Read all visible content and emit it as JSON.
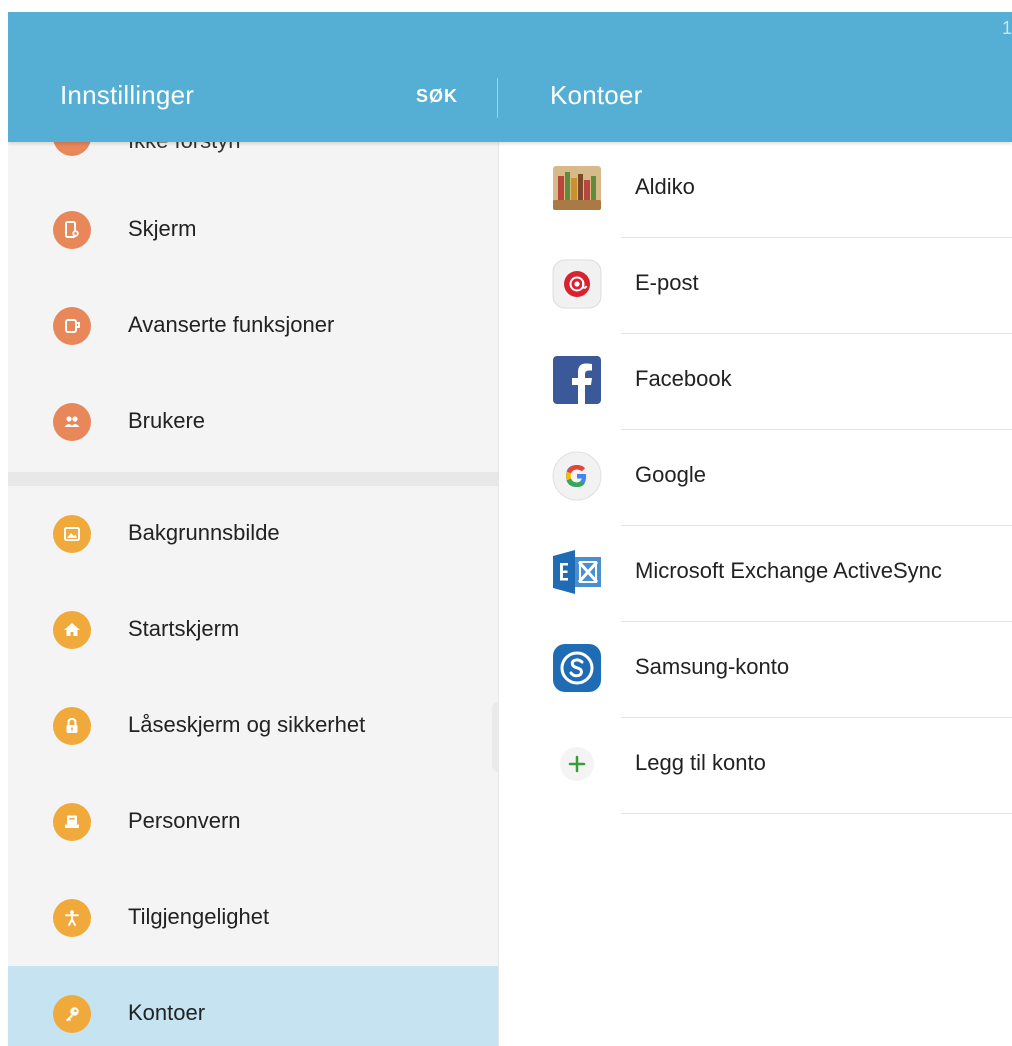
{
  "appbar": {
    "left_title": "Innstillinger",
    "search_label": "SØK",
    "right_title": "Kontoer",
    "corner_mark": "1"
  },
  "sidebar": {
    "cut_item_label": "Ikke forstyrr",
    "items": [
      {
        "label": "Skjerm",
        "icon": "display-icon",
        "color": "#e8875a"
      },
      {
        "label": "Avanserte funksjoner",
        "icon": "advanced-features-icon",
        "color": "#e8875a"
      },
      {
        "label": "Brukere",
        "icon": "users-icon",
        "color": "#e8875a"
      },
      {
        "label": "Bakgrunnsbilde",
        "icon": "wallpaper-icon",
        "color": "#f0a93b"
      },
      {
        "label": "Startskjerm",
        "icon": "home-icon",
        "color": "#f0a93b"
      },
      {
        "label": "Låseskjerm og sikkerhet",
        "icon": "lock-icon",
        "color": "#f0a93b"
      },
      {
        "label": "Personvern",
        "icon": "privacy-icon",
        "color": "#f0a93b"
      },
      {
        "label": "Tilgjengelighet",
        "icon": "accessibility-icon",
        "color": "#f0a93b"
      },
      {
        "label": "Kontoer",
        "icon": "key-icon",
        "color": "#f0a93b",
        "selected": true
      }
    ]
  },
  "accounts": {
    "items": [
      {
        "label": "Aldiko",
        "icon": "aldiko-books-icon"
      },
      {
        "label": "E-post",
        "icon": "email-at-icon"
      },
      {
        "label": "Facebook",
        "icon": "facebook-icon"
      },
      {
        "label": "Google",
        "icon": "google-icon"
      },
      {
        "label": "Microsoft Exchange ActiveSync",
        "icon": "exchange-icon"
      },
      {
        "label": "Samsung-konto",
        "icon": "samsung-account-icon"
      },
      {
        "label": "Legg til konto",
        "icon": "add-icon"
      }
    ]
  },
  "colors": {
    "appbar": "#55aed3",
    "selected_row": "#c5e3f1",
    "orange_group": "#e8875a",
    "amber_group": "#f0a93b",
    "add_green": "#3a9b3a"
  }
}
